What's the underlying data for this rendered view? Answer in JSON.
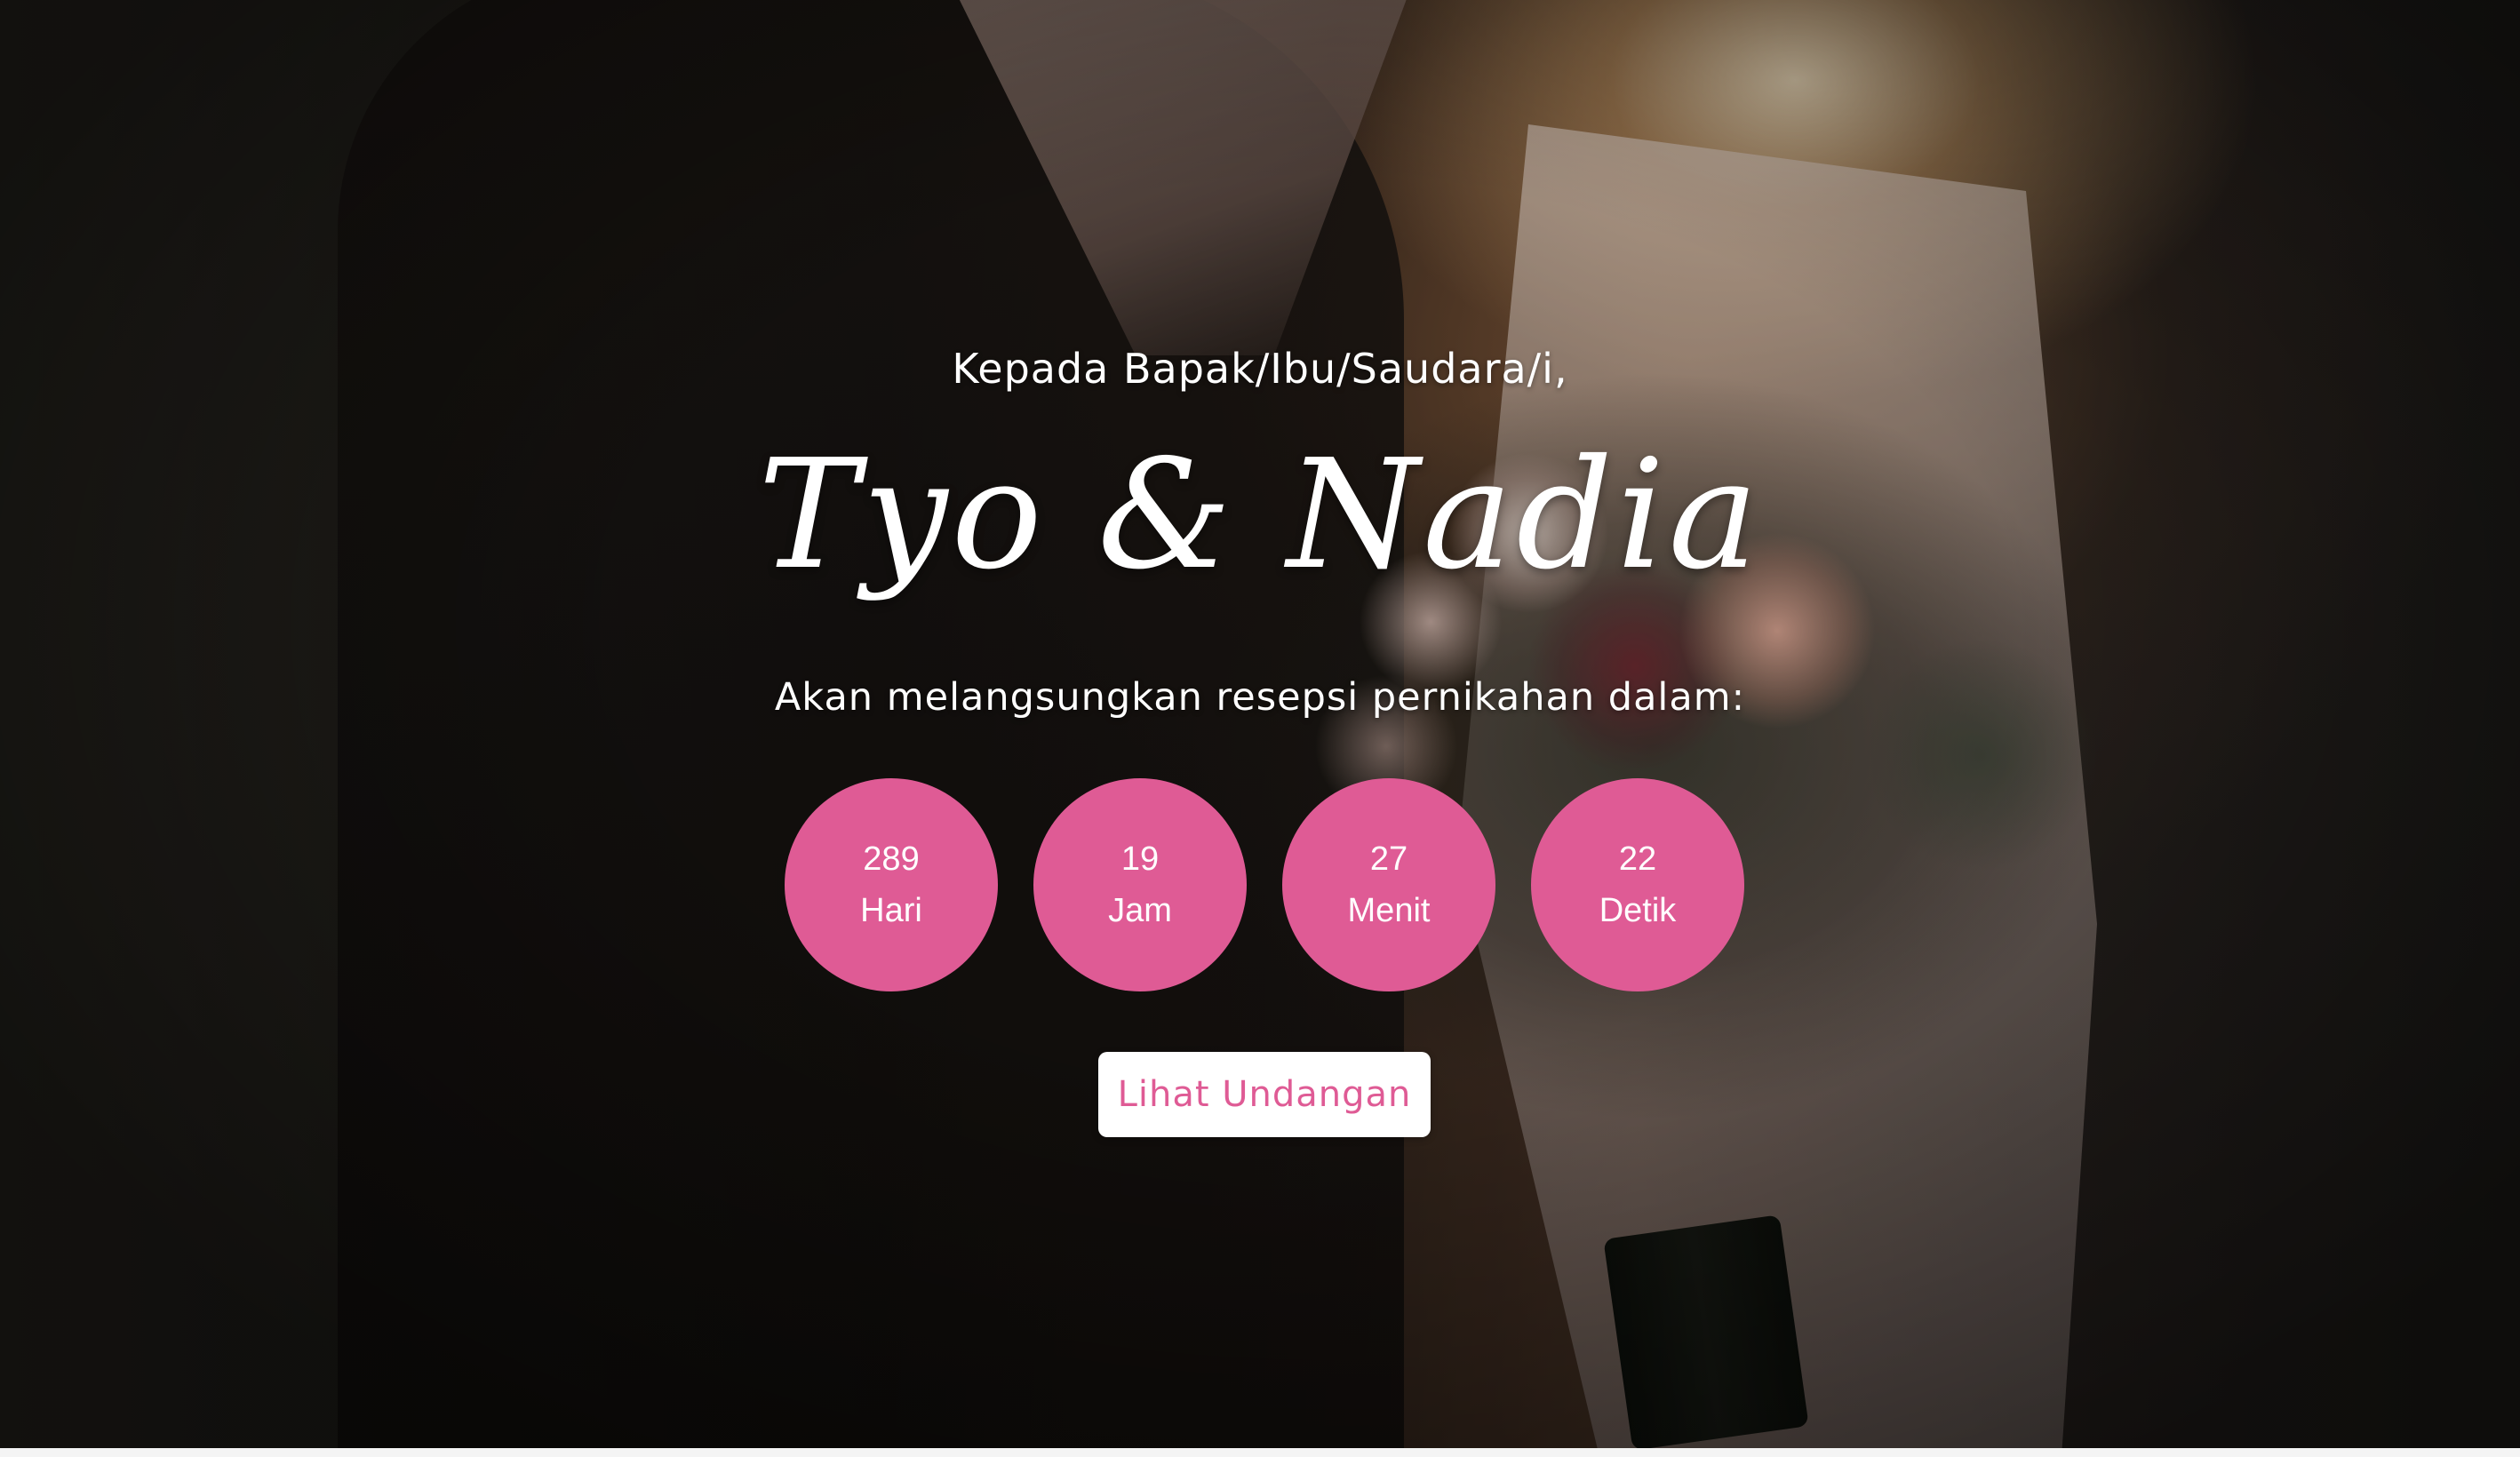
{
  "hero": {
    "greeting": "Kepada Bapak/Ibu/Saudara/i,",
    "couple_names": "Tyo & Nadia",
    "subtitle": "Akan melangsungkan resepsi pernikahan dalam:"
  },
  "countdown": [
    {
      "value": "289",
      "unit": "Hari"
    },
    {
      "value": "19",
      "unit": "Jam"
    },
    {
      "value": "27",
      "unit": "Menit"
    },
    {
      "value": "22",
      "unit": "Detik"
    }
  ],
  "cta": {
    "label": "Lihat Undangan"
  },
  "colors": {
    "accent": "#df5b95",
    "text": "#ffffff",
    "button_bg": "#ffffff"
  }
}
